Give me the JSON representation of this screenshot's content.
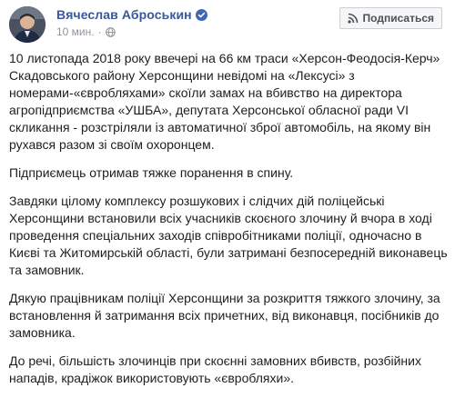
{
  "post": {
    "author": "Вячеслав Аброськин",
    "time": "10 мин.",
    "subscribe_label": "Подписаться",
    "icons": {
      "verified": "verified-badge-icon",
      "audience": "globe-icon",
      "subscribe": "rss-icon"
    },
    "paragraphs": [
      "10 листопада 2018 року ввечері на 66 км траси «Херсон-Феодосія-Керч» Скадовського району Херсонщини невідомі на «Лексусі» з номерами-«євробляхами» скоїли замах на вбивство на директора агропідприємства «УШБА», депутата Херсонської обласної ради VI скликання - розстріляли із автоматичної зброї автомобіль, на якому він рухався разом зі своїм охоронцем.",
      "Підприємець отримав тяжке поранення в спину.",
      "Завдяки цілому комплексу розшукових і слідчих дій поліцейські Херсонщини встановили всіх учасників скоєного злочину й вчора в ході проведення спеціальних заходів співробітниками поліції, одночасно в Києві та Житомирській області, були затримані безпосередній виконавець та замовник.",
      "Дякую працівникам поліції Херсонщини за розкриття тяжкого злочину, за встановлення й затримання всіх причетних, від виконавця, посібників до замовника.",
      "До речі, більшість злочинців при скоєнні замовних вбивств, розбійних нападів, крадіжок використовують «євробляхи»."
    ]
  },
  "colors": {
    "link": "#385898",
    "meta": "#90949c",
    "verified": "#4267b2",
    "text": "#1c1e21"
  }
}
